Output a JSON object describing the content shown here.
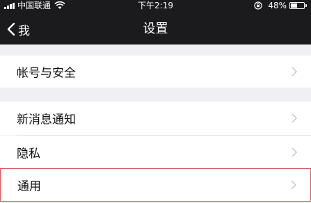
{
  "status_bar": {
    "carrier": "中国联通",
    "time": "下午2:19",
    "battery": "48%",
    "battery_level": 0.48,
    "icons": [
      "signal-icon",
      "wifi-icon",
      "rotation-lock-icon",
      "battery-icon"
    ]
  },
  "nav": {
    "back_label": "我",
    "title": "设置"
  },
  "groups": [
    {
      "items": [
        {
          "label": "帐号与安全"
        }
      ]
    },
    {
      "items": [
        {
          "label": "新消息通知"
        },
        {
          "label": "隐私"
        },
        {
          "label": "通用"
        }
      ]
    }
  ],
  "highlighted_item": "通用",
  "colors": {
    "navbar": "#1b1b1d",
    "background": "#efeff4",
    "highlight_border": "#d8575d",
    "chevron": "#c7c7cc"
  }
}
